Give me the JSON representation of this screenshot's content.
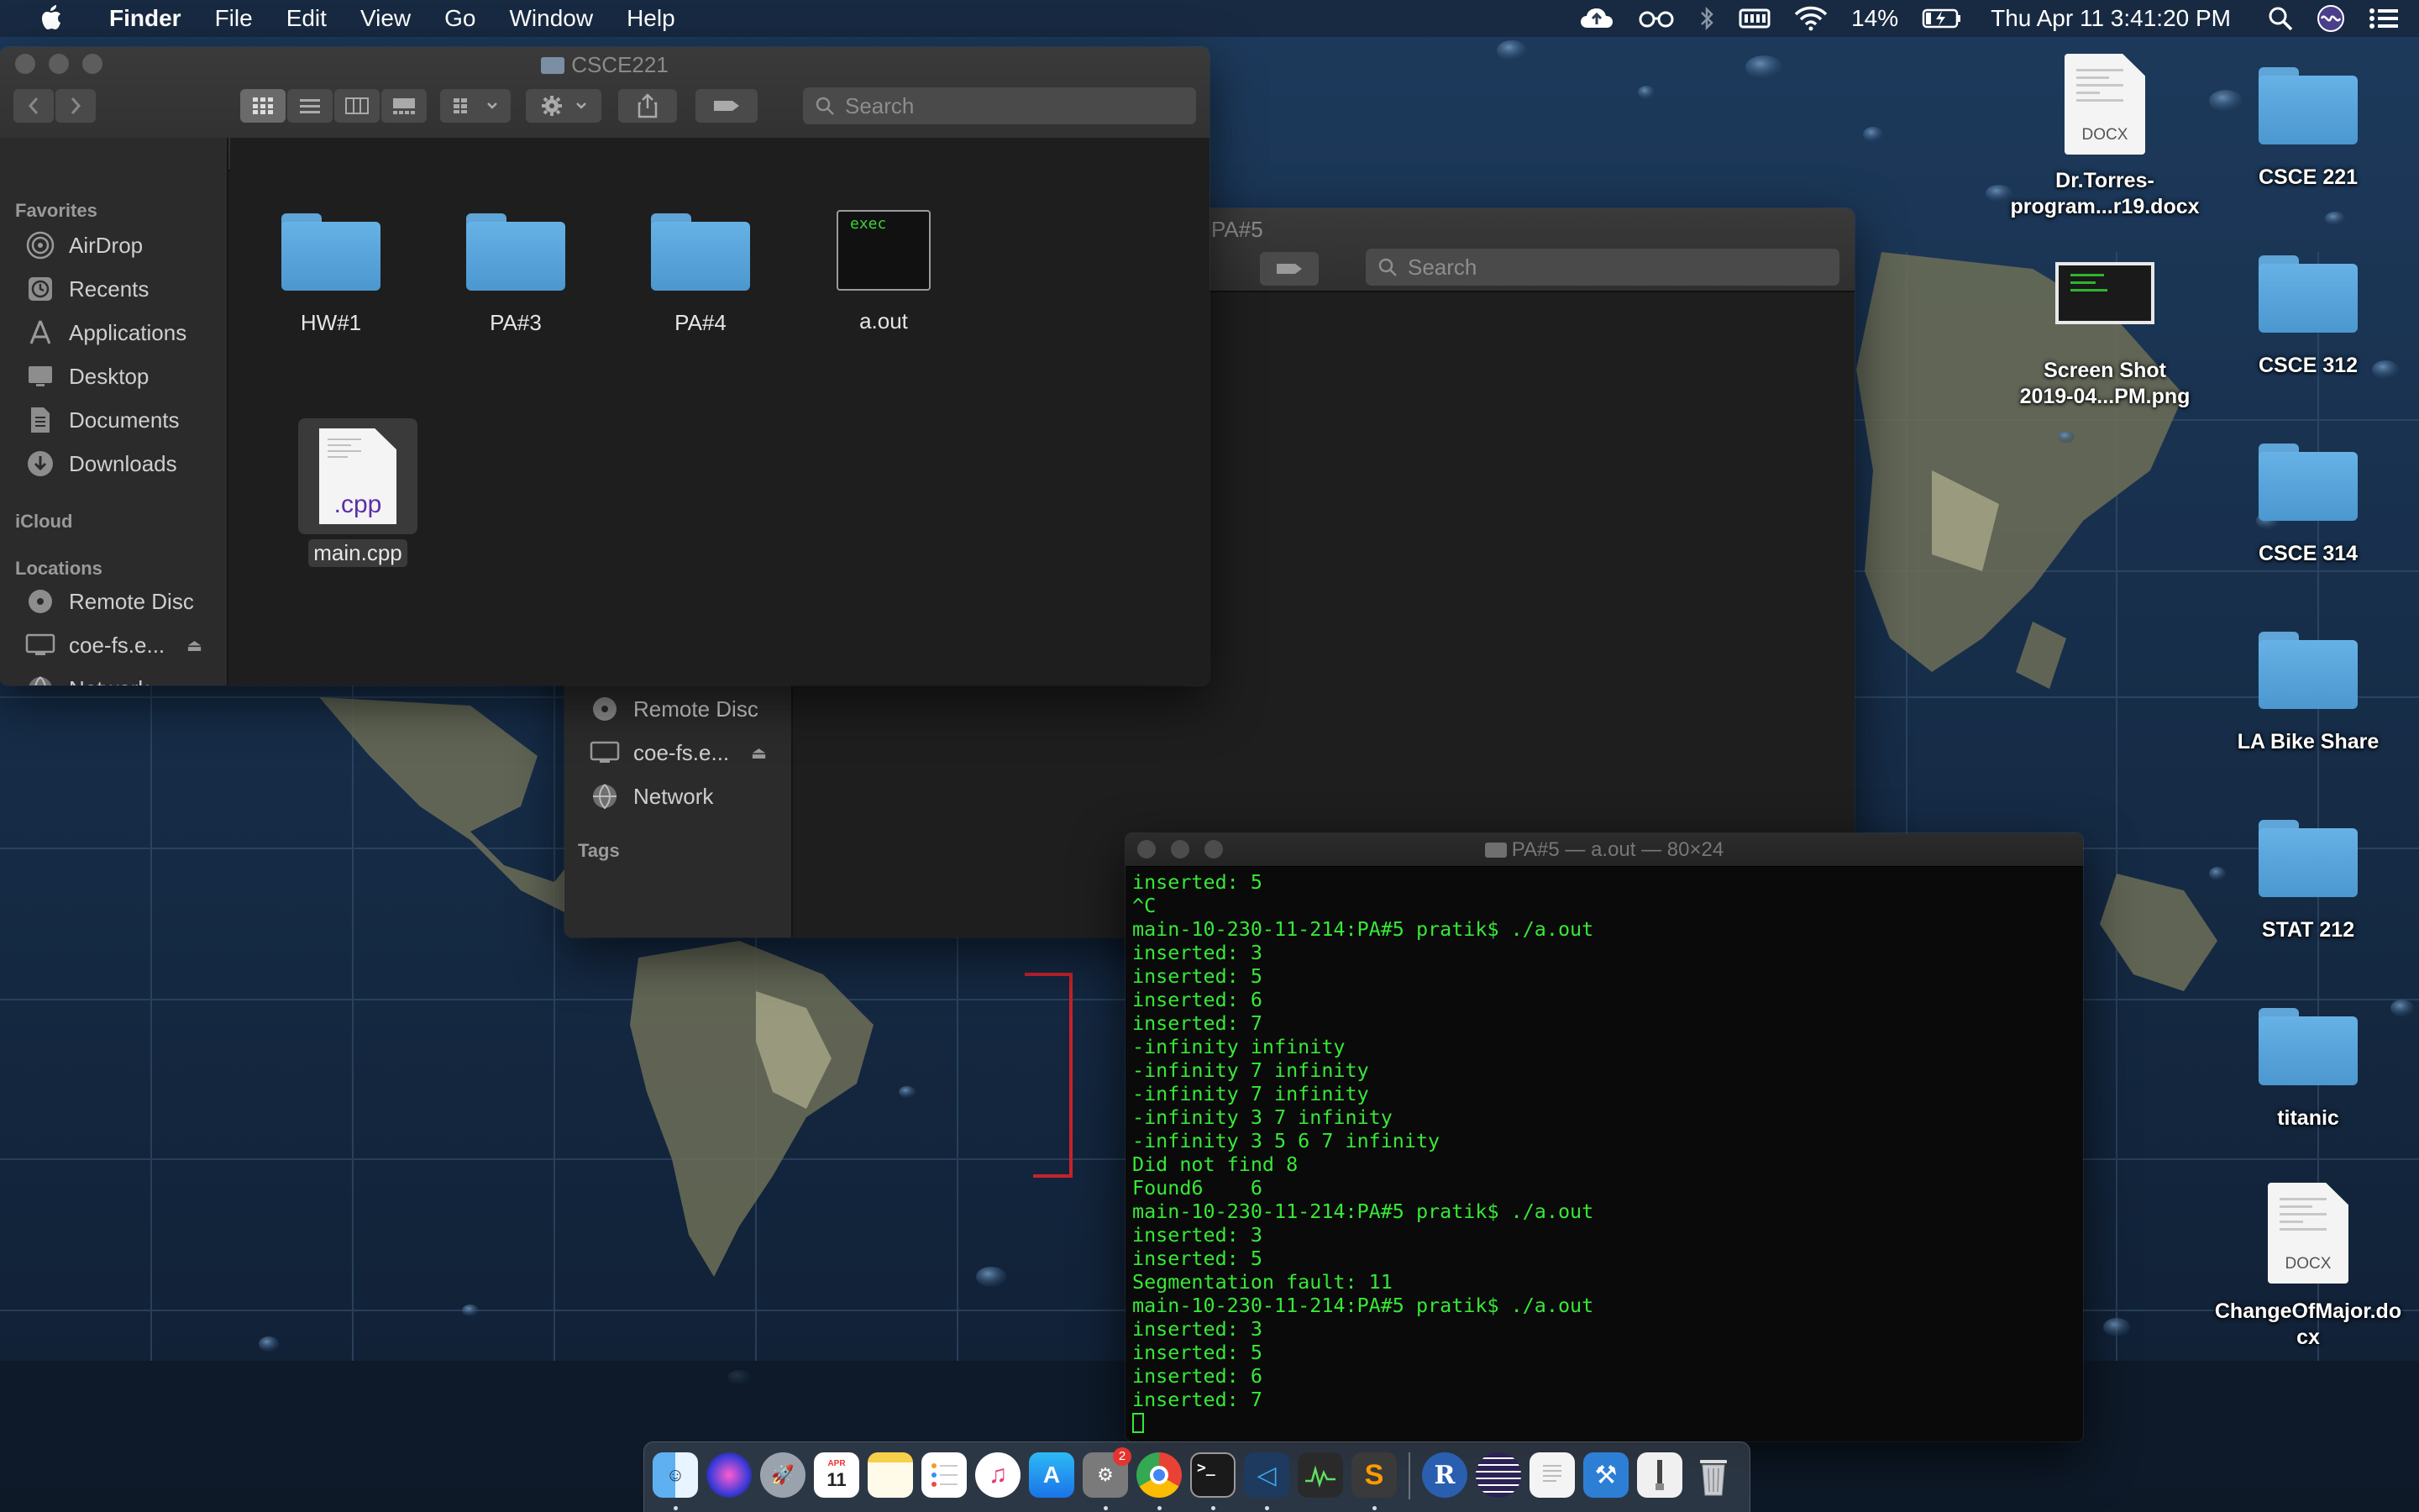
{
  "menubar": {
    "app_name": "Finder",
    "menus": [
      "File",
      "Edit",
      "View",
      "Go",
      "Window",
      "Help"
    ],
    "battery_percent": "14%",
    "clock": "Thu Apr 11  3:41:20 PM",
    "status_icons": [
      "cloud-upload-icon",
      "glasses-icon",
      "bluetooth-icon",
      "keyboard-icon",
      "wifi-icon",
      "battery-charging-icon",
      "search-icon",
      "siri-icon",
      "notification-center-icon"
    ]
  },
  "finder_front": {
    "title": "CSCE221",
    "search_placeholder": "Search",
    "sidebar": {
      "favorites_header": "Favorites",
      "favorites": [
        "AirDrop",
        "Recents",
        "Applications",
        "Desktop",
        "Documents",
        "Downloads"
      ],
      "icloud_header": "iCloud",
      "locations_header": "Locations",
      "locations": [
        "Remote Disc",
        "coe-fs.e...",
        "Network"
      ]
    },
    "files": [
      {
        "name": "HW#1",
        "kind": "folder"
      },
      {
        "name": "PA#3",
        "kind": "folder"
      },
      {
        "name": "PA#4",
        "kind": "folder"
      },
      {
        "name": "a.out",
        "kind": "exec",
        "badge": "exec"
      },
      {
        "name": "main.cpp",
        "kind": "cpp",
        "badge": ".cpp"
      }
    ]
  },
  "finder_back": {
    "title": "PA#5",
    "search_placeholder": "Search",
    "locations": [
      "Remote Disc",
      "coe-fs.e...",
      "Network"
    ],
    "tags_header": "Tags"
  },
  "terminal": {
    "title": "PA#5 — a.out — 80×24",
    "lines": [
      "inserted: 5",
      "^C",
      "main-10-230-11-214:PA#5 pratik$ ./a.out",
      "inserted: 3",
      "inserted: 5",
      "inserted: 6",
      "inserted: 7",
      "-infinity infinity",
      "-infinity 7 infinity",
      "-infinity 7 infinity",
      "-infinity 3 7 infinity",
      "-infinity 3 5 6 7 infinity",
      "Did not find 8",
      "Found6    6",
      "main-10-230-11-214:PA#5 pratik$ ./a.out",
      "inserted: 3",
      "inserted: 5",
      "Segmentation fault: 11",
      "main-10-230-11-214:PA#5 pratik$ ./a.out",
      "inserted: 3",
      "inserted: 5",
      "inserted: 6",
      "inserted: 7"
    ],
    "text_color": "#37e837"
  },
  "desktop": {
    "doc1": {
      "line1": "Dr.Torres-",
      "line2": "program...r19.docx",
      "kind": "DOCX"
    },
    "screenshot": {
      "line1": "Screen Shot",
      "line2": "2019-04...PM.png"
    },
    "folders": [
      "CSCE 221",
      "CSCE 312",
      "CSCE 314",
      "LA Bike Share",
      "STAT 212",
      "titanic"
    ],
    "doc2": {
      "line1": "ChangeOfMajor.do",
      "line2": "cx",
      "kind": "DOCX"
    }
  },
  "dock": {
    "apps": [
      "finder-icon",
      "siri-icon",
      "launchpad-icon",
      "calendar-icon",
      "notes-icon",
      "reminders-icon",
      "itunes-icon",
      "app-store-icon",
      "system-preferences-icon",
      "chrome-icon",
      "terminal-icon",
      "vscode-icon",
      "activity-monitor-icon",
      "sublime-text-icon",
      "r-icon",
      "eclipse-icon",
      "textedit-icon",
      "xcode-icon",
      "archive-icon",
      "trash-icon"
    ],
    "calendar_day": "11",
    "calendar_month": "APR",
    "prefs_badge": "2"
  },
  "colors": {
    "folder_blue": "#5fa5d8",
    "finder_bg": "#1e1e1e",
    "sidebar_bg": "#2b2b2b",
    "terminal_green": "#37e837"
  }
}
